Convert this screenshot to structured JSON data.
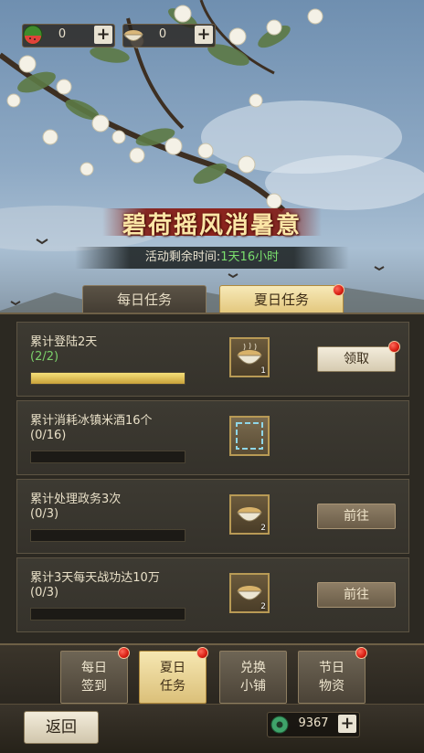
{
  "resources": [
    {
      "icon": "watermelon-icon",
      "value": "0",
      "add": "+"
    },
    {
      "icon": "congee-bowl-icon",
      "value": "0",
      "add": "+"
    }
  ],
  "event": {
    "title": "碧荷摇风消暑意",
    "timer_label": "活动剩余时间:",
    "timer_value": "1天16小时"
  },
  "tabs": [
    {
      "label": "每日任务",
      "active": false,
      "badge": false
    },
    {
      "label": "夏日任务",
      "active": true,
      "badge": true
    }
  ],
  "tasks": [
    {
      "name": "累计登陆2天",
      "progress": "(2/2)",
      "fraction": 1.0,
      "reward_icon": "congee-bowl-icon",
      "reward_count": "1",
      "button": "领取",
      "button_type": "claim",
      "badge": true
    },
    {
      "name": "累计消耗冰镇米酒16个",
      "progress": "(0/16)",
      "fraction": 0.0,
      "reward_icon": "empty-frame-icon",
      "reward_count": "",
      "button": "",
      "button_type": "none",
      "badge": false
    },
    {
      "name": "累计处理政务3次",
      "progress": "(0/3)",
      "fraction": 0.0,
      "reward_icon": "congee-bowl-icon",
      "reward_count": "2",
      "button": "前往",
      "button_type": "go",
      "badge": false
    },
    {
      "name": "累计3天每天战功达10万",
      "progress": "(0/3)",
      "fraction": 0.0,
      "reward_icon": "congee-bowl-icon",
      "reward_count": "2",
      "button": "前往",
      "button_type": "go",
      "badge": false
    }
  ],
  "dock": [
    {
      "line1": "每日",
      "line2": "签到",
      "active": false,
      "badge": true
    },
    {
      "line1": "夏日",
      "line2": "任务",
      "active": true,
      "badge": true
    },
    {
      "line1": "兑换",
      "line2": "小铺",
      "active": false,
      "badge": false
    },
    {
      "line1": "节日",
      "line2": "物资",
      "active": false,
      "badge": true
    }
  ],
  "footer": {
    "back_label": "返回",
    "jade_icon": "jade-coin-icon",
    "jade_value": "9367",
    "add": "+"
  },
  "colors": {
    "accent_gold": "#e3c77c",
    "timer_green": "#7be06e",
    "badge_red": "#d81e12"
  }
}
